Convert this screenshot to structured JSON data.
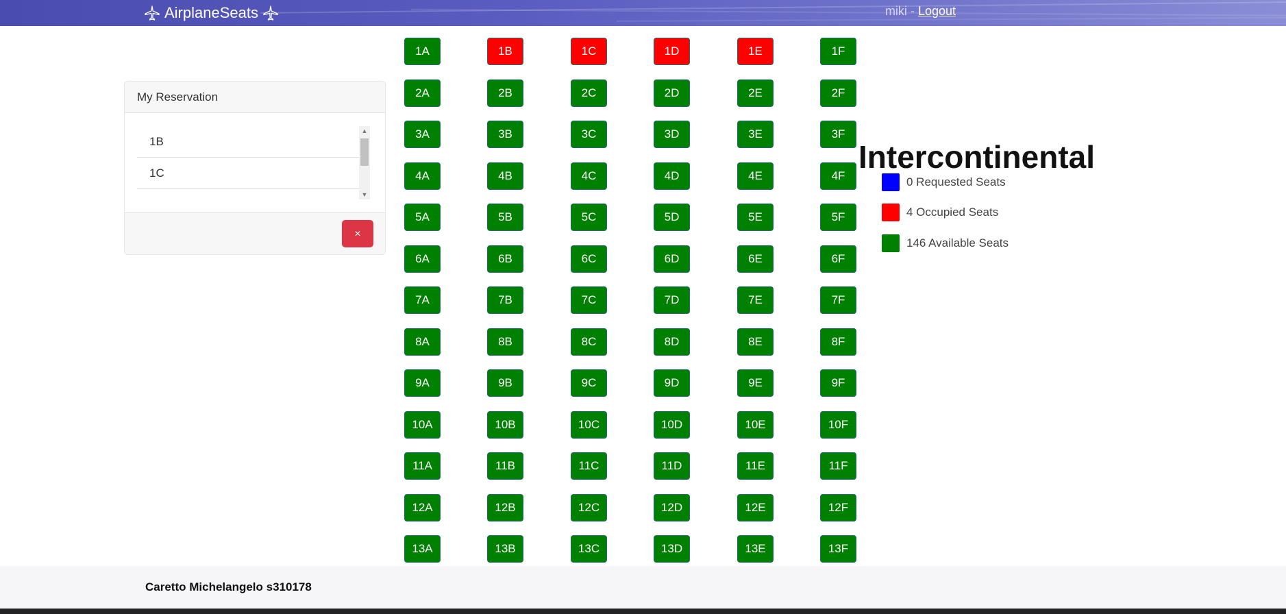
{
  "header": {
    "brand": "AirplaneSeats",
    "user": "miki",
    "separator": " - ",
    "logout": "Logout"
  },
  "reservation": {
    "title": "My Reservation",
    "seats": [
      "1B",
      "1C"
    ],
    "cancel_label": "×"
  },
  "seatmap": {
    "rows": 13,
    "columns": [
      "A",
      "B",
      "C",
      "D",
      "E",
      "F"
    ],
    "occupied": [
      "1B",
      "1C",
      "1D",
      "1E"
    ],
    "requested": []
  },
  "legend": {
    "title": "Intercontinental",
    "requested": "0 Requested Seats",
    "occupied": "4 Occupied Seats",
    "available": "146 Available Seats"
  },
  "colors": {
    "available": "#008000",
    "occupied": "#ff0000",
    "requested": "#0000ff",
    "cancel": "#dc3545"
  },
  "footer": {
    "author": "Caretto Michelangelo s310178"
  }
}
